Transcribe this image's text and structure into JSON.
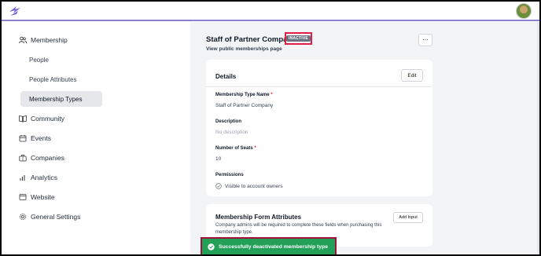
{
  "topbar": {
    "logo_icon": "lightning-logo-icon",
    "avatar_icon": "user-avatar"
  },
  "sidebar": {
    "items": [
      {
        "label": "Membership",
        "icon": "users-icon"
      },
      {
        "label": "People"
      },
      {
        "label": "People Attributes"
      },
      {
        "label": "Membership Types",
        "active": true
      },
      {
        "label": "Community",
        "icon": "book-icon"
      },
      {
        "label": "Events",
        "icon": "calendar-icon"
      },
      {
        "label": "Companies",
        "icon": "briefcase-icon"
      },
      {
        "label": "Analytics",
        "icon": "bar-chart-icon"
      },
      {
        "label": "Website",
        "icon": "globe-icon"
      },
      {
        "label": "General Settings",
        "icon": "gear-icon"
      }
    ]
  },
  "header": {
    "title": "Staff of Partner Company",
    "status_badge": "INACTIVE",
    "public_link": "View public memberships page",
    "more_label": "···"
  },
  "details": {
    "title": "Details",
    "edit_label": "Edit",
    "type_name_label": "Membership Type Name",
    "type_name_value": "Staff of Partner Company",
    "description_label": "Description",
    "description_value": "No description",
    "seats_label": "Number of Seats",
    "seats_value": "10",
    "permissions_label": "Permissions",
    "permissions_value": "Visible to account owners",
    "required_mark": "*"
  },
  "form_attributes": {
    "title": "Membership Form Attributes",
    "add_label": "Add Input",
    "description": "Company admins will be required to complete these fields when purchasing this membership type."
  },
  "toast": {
    "message": "Successfully deactivated membership type",
    "color": "#22a058"
  },
  "colors": {
    "accent": "#8b7fd0",
    "highlight": "#e11d48",
    "badge": "#6b7280"
  }
}
